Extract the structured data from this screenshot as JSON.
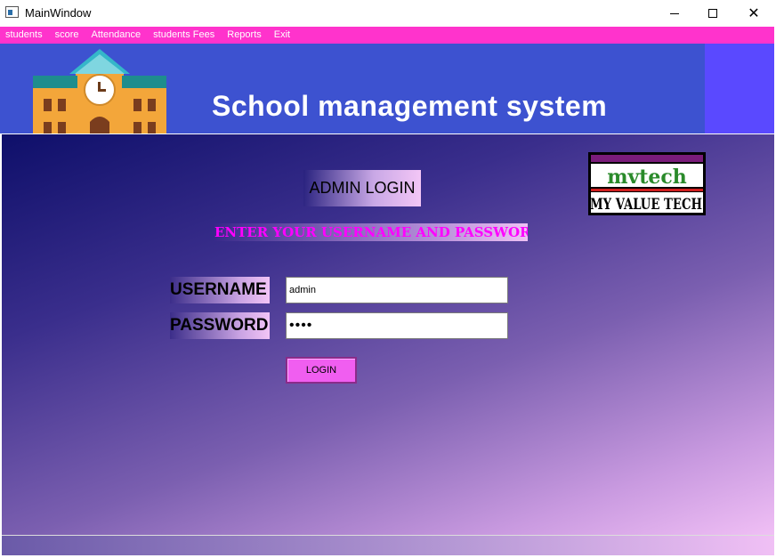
{
  "window": {
    "title": "MainWindow",
    "controls": {
      "minimize": "minimize",
      "maximize": "maximize",
      "close": "✕"
    }
  },
  "menu": {
    "items": [
      "students",
      "score",
      "Attendance",
      "students Fees",
      "Reports",
      "Exit"
    ]
  },
  "banner": {
    "title": "School management system"
  },
  "login": {
    "heading": "ADMIN LOGIN",
    "instruction": "ENTER YOUR USERNAME AND PASSWORD",
    "username_label": "USERNAME",
    "password_label": "PASSWORD",
    "username_value": "admin",
    "password_value": "••••",
    "button_label": "LOGIN"
  },
  "logo": {
    "top_text": "mvtech",
    "bottom_text": "MY VALUE TECH"
  },
  "colors": {
    "menubar": "#ff33cc",
    "banner": "#3d52d0",
    "instruction_text": "#ff00ff",
    "login_button": "#f05ef0"
  }
}
